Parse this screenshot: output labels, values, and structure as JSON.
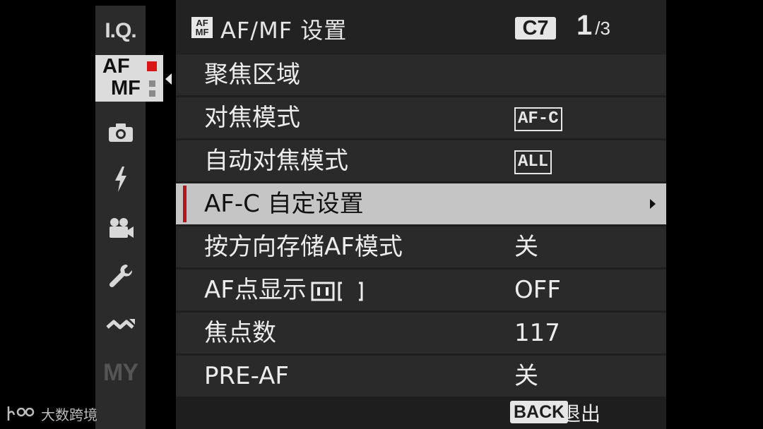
{
  "sidebar": {
    "iq_label": "I.Q.",
    "af_label_top": "AF",
    "af_label_bottom": "MF",
    "my_label": "MY"
  },
  "header": {
    "title": "AF/MF 设置",
    "icon_text_top": "AF",
    "icon_text_bottom": "MF",
    "badge": "C7",
    "page_current": "1",
    "page_total": "/3"
  },
  "menu": {
    "items": [
      {
        "label": "聚焦区域",
        "value": ""
      },
      {
        "label": "对焦模式",
        "value": "AF-C"
      },
      {
        "label": "自动对焦模式",
        "value": "ALL"
      },
      {
        "label": "AF-C 自定设置",
        "value": ""
      },
      {
        "label": "按方向存储AF模式",
        "value": "关"
      },
      {
        "label": "AF点显示",
        "value": "OFF"
      },
      {
        "label": "焦点数",
        "value": "117"
      },
      {
        "label": "PRE-AF",
        "value": "关"
      }
    ]
  },
  "footer": {
    "back_label": "BACK",
    "exit_label": "退出"
  },
  "watermark": {
    "text": "大数跨境"
  },
  "colors": {
    "accent_red": "#d8161a",
    "selection_bar": "#b3161b",
    "selected_row": "#c5c5c5"
  }
}
